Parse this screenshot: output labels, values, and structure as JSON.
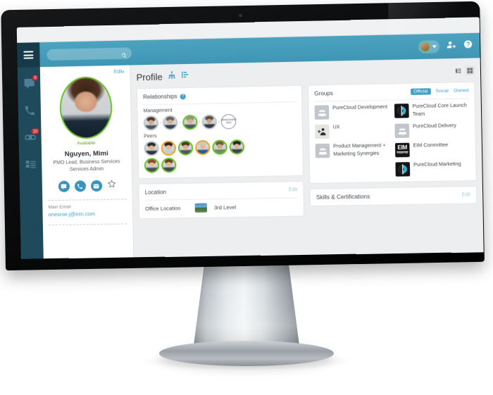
{
  "app": {
    "search": {
      "placeholder": "",
      "value": "",
      "icon": "search-icon"
    },
    "hamburger_icon": "hamburger-menu-icon",
    "rail": [
      {
        "name": "chat",
        "icon": "chat-bubble-icon",
        "badge": "0"
      },
      {
        "name": "calls",
        "icon": "phone-icon",
        "badge": ""
      },
      {
        "name": "voicemail",
        "icon": "voicemail-icon",
        "badge": "10"
      },
      {
        "name": "directory",
        "icon": "contacts-list-icon",
        "badge": ""
      }
    ],
    "topbar_right": {
      "user_caret": "chevron-down-icon",
      "add_person_icon": "add-person-icon",
      "help_icon": "help-circle-icon"
    }
  },
  "profile_panel": {
    "edit_label": "Edit",
    "edit_caret": "▾",
    "status": "Available",
    "name": "Nguyen, Mimi",
    "title_line1": "PMO Lead, Business Services",
    "title_line2": "Services Admin",
    "actions": [
      {
        "label": "chat",
        "icon": "chat-bubble-icon"
      },
      {
        "label": "call",
        "icon": "phone-icon"
      },
      {
        "label": "email",
        "icon": "envelope-icon"
      },
      {
        "label": "favorite",
        "icon": "star-outline-icon"
      }
    ],
    "field_label": "Main Email",
    "field_value": "onesroe.j@inin.com"
  },
  "page": {
    "title": "Profile",
    "header_icons": [
      {
        "name": "org-chart-icon"
      },
      {
        "name": "hierarchy-list-icon"
      }
    ],
    "view_toggle": [
      {
        "name": "list-view-icon",
        "active": false
      },
      {
        "name": "grid-view-icon",
        "active": true
      }
    ]
  },
  "relationships": {
    "title": "Relationships",
    "help_icon": "?",
    "management_label": "Management",
    "management": [
      {
        "ring": "gray",
        "skin": "#d7a887",
        "hair": "#4a3a2c",
        "shirt": "#4a5560"
      },
      {
        "ring": "gray",
        "skin": "#d9ae8c",
        "hair": "#6b6259",
        "shirt": "#3a4450"
      },
      {
        "ring": "green",
        "skin": "#dcb089",
        "hair": "#9a9288",
        "shirt": "#4d5862"
      },
      {
        "ring": "gray",
        "skin": "#cfa181",
        "hair": "#5a5048",
        "shirt": "#343d47"
      },
      {
        "ring": "seal",
        "seal_text": "MANAGEMENT SEAL"
      }
    ],
    "peers_label": "Peers",
    "peers": [
      {
        "ring": "gray",
        "skin": "#e0b48f",
        "hair": "#2f2a26",
        "shirt": "#2d3640"
      },
      {
        "ring": "orange",
        "skin": "#e2b795",
        "hair": "#3a2216",
        "shirt": "#c9ccce"
      },
      {
        "ring": "green",
        "skin": "#dfae89",
        "hair": "#503626",
        "shirt": "#4b5662"
      },
      {
        "ring": "orange",
        "skin": "#e3b896",
        "hair": "#cfc7bd",
        "shirt": "#2e5a8f"
      },
      {
        "ring": "green",
        "skin": "#d9a77f",
        "hair": "#6b5a46",
        "shirt": "#6f8a5b"
      },
      {
        "ring": "green",
        "skin": "#e1b391",
        "hair": "#2b2320",
        "shirt": "#3b4450"
      },
      {
        "ring": "green",
        "skin": "#e6bc9a",
        "hair": "#8a4a26",
        "shirt": "#4a4e55"
      },
      {
        "ring": "green",
        "skin": "#e2b894",
        "hair": "#6d4326",
        "shirt": "#3f4a56"
      }
    ]
  },
  "groups": {
    "title": "Groups",
    "tabs": [
      {
        "label": "Official",
        "active": true
      },
      {
        "label": "Social",
        "active": false
      },
      {
        "label": "Owned",
        "active": false
      }
    ],
    "left_items": [
      {
        "name": "PureCloud Development",
        "icon": "people-group-icon",
        "style": "people"
      },
      {
        "name": "UX",
        "icon": "ux-person-icon",
        "style": "light"
      },
      {
        "name": "Product Management + Marketing Synergies",
        "icon": "people-group-icon",
        "style": "people"
      }
    ],
    "right_items": [
      {
        "name": "PureCloud Core Launch Team",
        "icon": "purecloud-logo-icon",
        "style": "dark"
      },
      {
        "name": "PureCloud Delivery",
        "icon": "people-group-icon",
        "style": "people"
      },
      {
        "name": "EIM Committee",
        "icon": "eim-badge-icon",
        "style": "eim",
        "eim_top": "EIM",
        "eim_bottom": "COMMITTEE"
      },
      {
        "name": "PureCloud Marketing",
        "icon": "purecloud-logo-icon",
        "style": "dark"
      }
    ]
  },
  "location": {
    "title": "Location",
    "edit_label": "Edit",
    "row_label": "Office Location",
    "row_value": "3rd Level",
    "thumb_icon": "building-photo-icon"
  },
  "skills": {
    "title": "Skills & Certifications",
    "edit_label": "Edit"
  },
  "colors": {
    "accent": "#3f9fc4",
    "header": "#4ba3c0",
    "rail": "#1e4a5c",
    "available": "#62c31f",
    "away": "#f0a419",
    "badge": "#d9232d"
  }
}
